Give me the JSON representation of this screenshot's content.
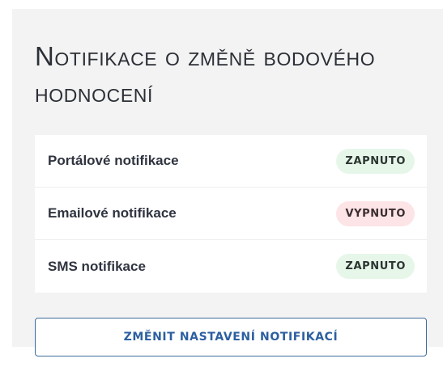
{
  "panel": {
    "title": "Notifikace o změně bodového hodnocení"
  },
  "notifications": [
    {
      "label": "Portálové notifikace",
      "status": "ZAPNUTO",
      "state": "on"
    },
    {
      "label": "Emailové notifikace",
      "status": "VYPNUTO",
      "state": "off"
    },
    {
      "label": "SMS notifikace",
      "status": "ZAPNUTO",
      "state": "on"
    }
  ],
  "actions": {
    "change_settings_label": "ZMĚNIT NASTAVENÍ NOTIFIKACÍ"
  },
  "colors": {
    "panel_bg": "#f3f3f3",
    "on_badge_bg": "#e6f7ea",
    "off_badge_bg": "#fde4e6",
    "accent": "#2c5fa0"
  }
}
